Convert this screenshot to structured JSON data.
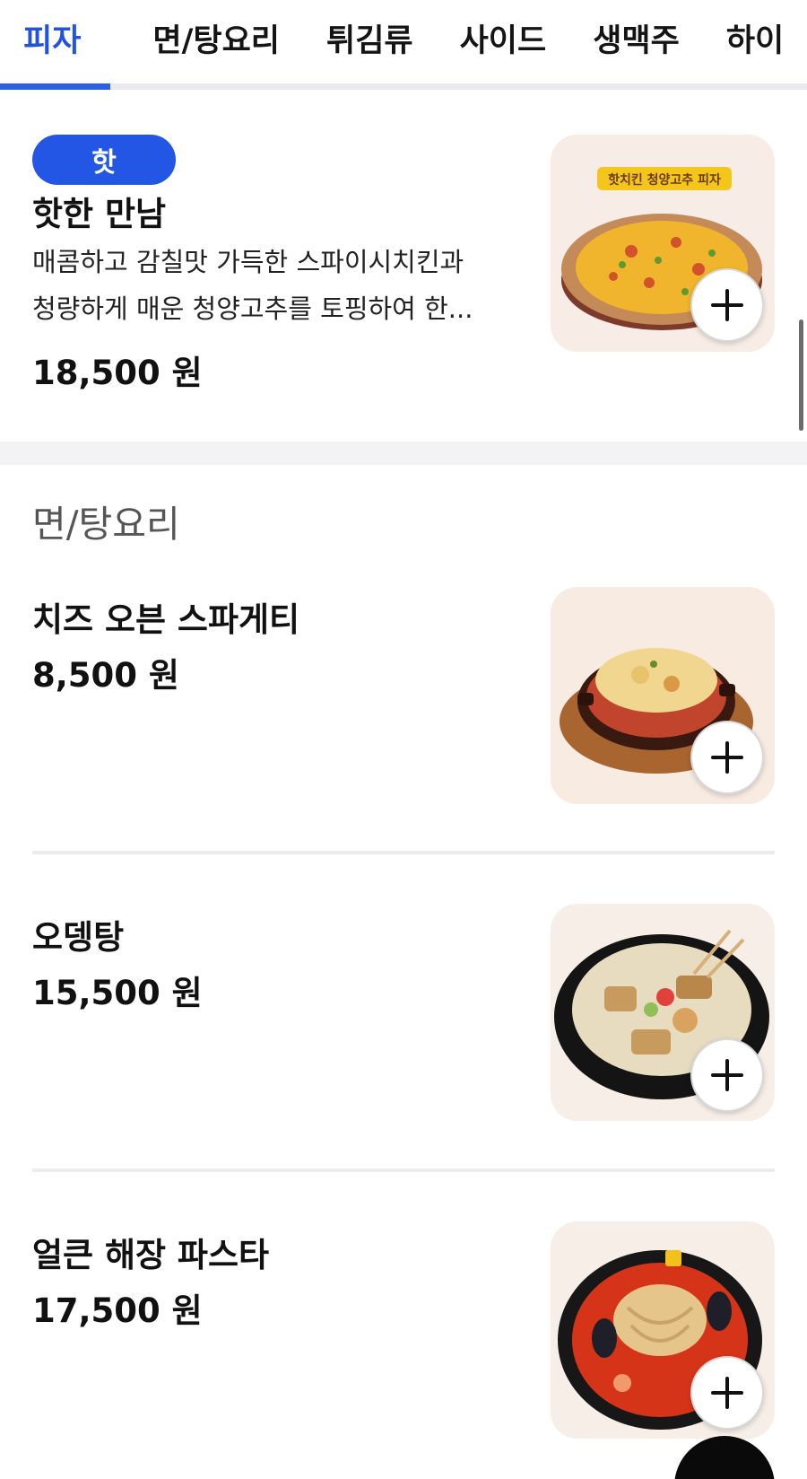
{
  "tabs": [
    "피자",
    "면/탕요리",
    "튀김류",
    "사이드",
    "생맥주",
    "하이"
  ],
  "active_tab": "피자",
  "items": [
    {
      "badge": "핫",
      "name": "핫한 만남",
      "desc_line1": "매콤하고 감칠맛 가득한 스파이시치킨과",
      "desc_line2": "청량하게 매운 청양고추를 토핑하여 한...",
      "price": "18,500 원",
      "image_label": "핫치킨 청양고추 피자"
    },
    {
      "name": "치즈 오븐 스파게티",
      "price": "8,500 원"
    },
    {
      "name": "오뎅탕",
      "price": "15,500 원"
    },
    {
      "name": "얼큰 해장 파스타",
      "price": "17,500 원"
    }
  ],
  "section": {
    "title": "면/탕요리"
  },
  "colors": {
    "accent": "#2b5fe4",
    "badge": "#2456e6",
    "section_gap": "#f3f3f5"
  },
  "icons": {
    "add": "plus-icon"
  }
}
